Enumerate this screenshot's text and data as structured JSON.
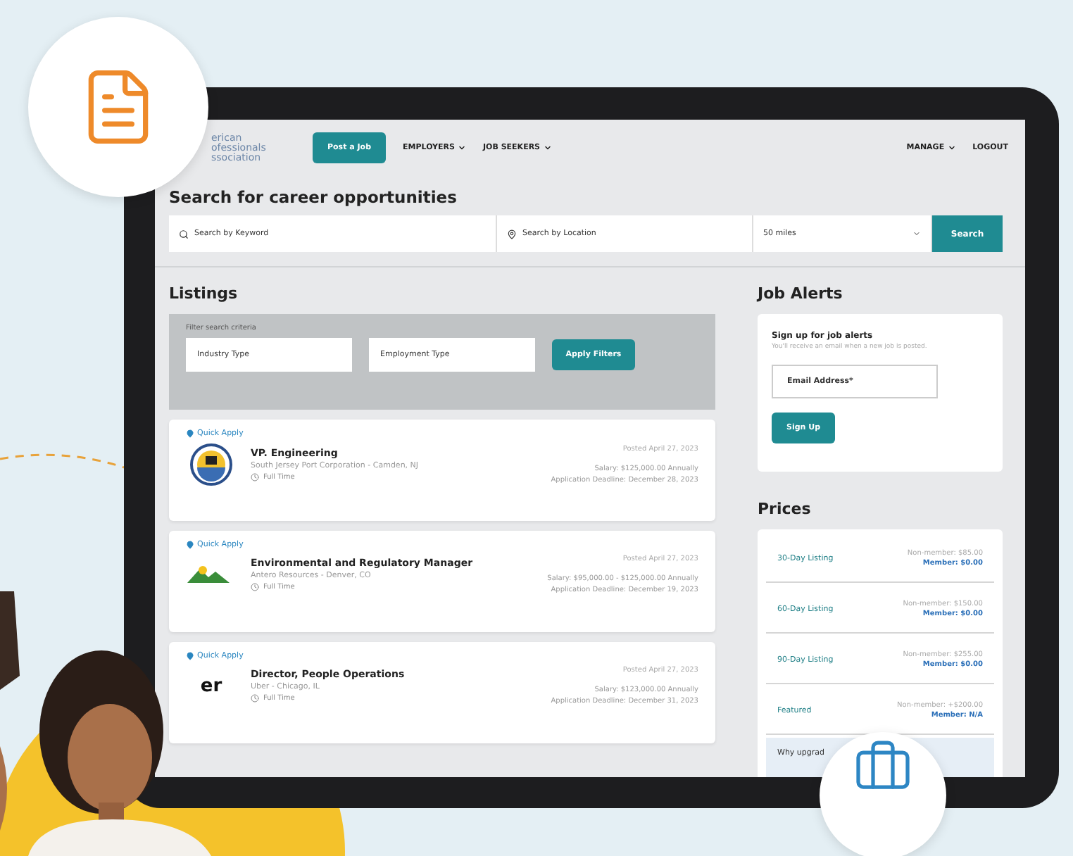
{
  "nav": {
    "logo_lines": [
      "erican",
      "ofessionals",
      "ssociation"
    ],
    "post_button": "Post a Job",
    "menus": [
      {
        "label": "EMPLOYERS",
        "dropdown": true
      },
      {
        "label": "JOB SEEKERS",
        "dropdown": true
      }
    ],
    "right_menus": [
      {
        "label": "MANAGE",
        "dropdown": true
      },
      {
        "label": "LOGOUT",
        "dropdown": false
      }
    ]
  },
  "search": {
    "title": "Search for career opportunities",
    "keyword_placeholder": "Search by Keyword",
    "location_placeholder": "Search by Location",
    "distance": "50 miles",
    "button": "Search"
  },
  "listings": {
    "title": "Listings",
    "filter_label": "Filter search criteria",
    "filters": [
      "Industry Type",
      "Employment Type"
    ],
    "apply": "Apply Filters",
    "jobs": [
      {
        "quick_apply": "Quick Apply",
        "logo": {
          "kind": "seal"
        },
        "title": "VP. Engineering",
        "company": "South Jersey Port Corporation - Camden, NJ",
        "type": "Full Time",
        "posted": "Posted April 27, 2023",
        "salary": "Salary: $125,000.00 Annually",
        "deadline": "Application Deadline: December 28, 2023"
      },
      {
        "quick_apply": "Quick Apply",
        "logo": {
          "kind": "mountain"
        },
        "title": "Environmental and Regulatory Manager",
        "company": "Antero Resources - Denver, CO",
        "type": "Full Time",
        "posted": "Posted April 27, 2023",
        "salary": "Salary: $95,000.00 - $125,000.00 Annually",
        "deadline": "Application Deadline: December 19, 2023"
      },
      {
        "quick_apply": "Quick Apply",
        "logo": {
          "kind": "wordmark",
          "text": "er"
        },
        "title": "Director, People Operations",
        "company": "Uber - Chicago, IL",
        "type": "Full Time",
        "posted": "Posted April 27, 2023",
        "salary": "Salary: $123,000.00 Annually",
        "deadline": "Application Deadline: December 31, 2023"
      }
    ]
  },
  "job_alerts": {
    "title": "Job Alerts",
    "heading": "Sign up for job alerts",
    "note": "You'll receive an email when a new job is posted.",
    "email_placeholder": "Email Address*",
    "button": "Sign Up"
  },
  "prices": {
    "title": "Prices",
    "rows": [
      {
        "name": "30-Day Listing",
        "non_member": "Non-member: $85.00",
        "member": "Member: $0.00"
      },
      {
        "name": "60-Day Listing",
        "non_member": "Non-member: $150.00",
        "member": "Member: $0.00"
      },
      {
        "name": "90-Day Listing",
        "non_member": "Non-member: $255.00",
        "member": "Member: $0.00"
      },
      {
        "name": "Featured",
        "non_member": "Non-member: +$200.00",
        "member": "Member: N/A"
      }
    ],
    "upgrade": "Why upgrad"
  }
}
